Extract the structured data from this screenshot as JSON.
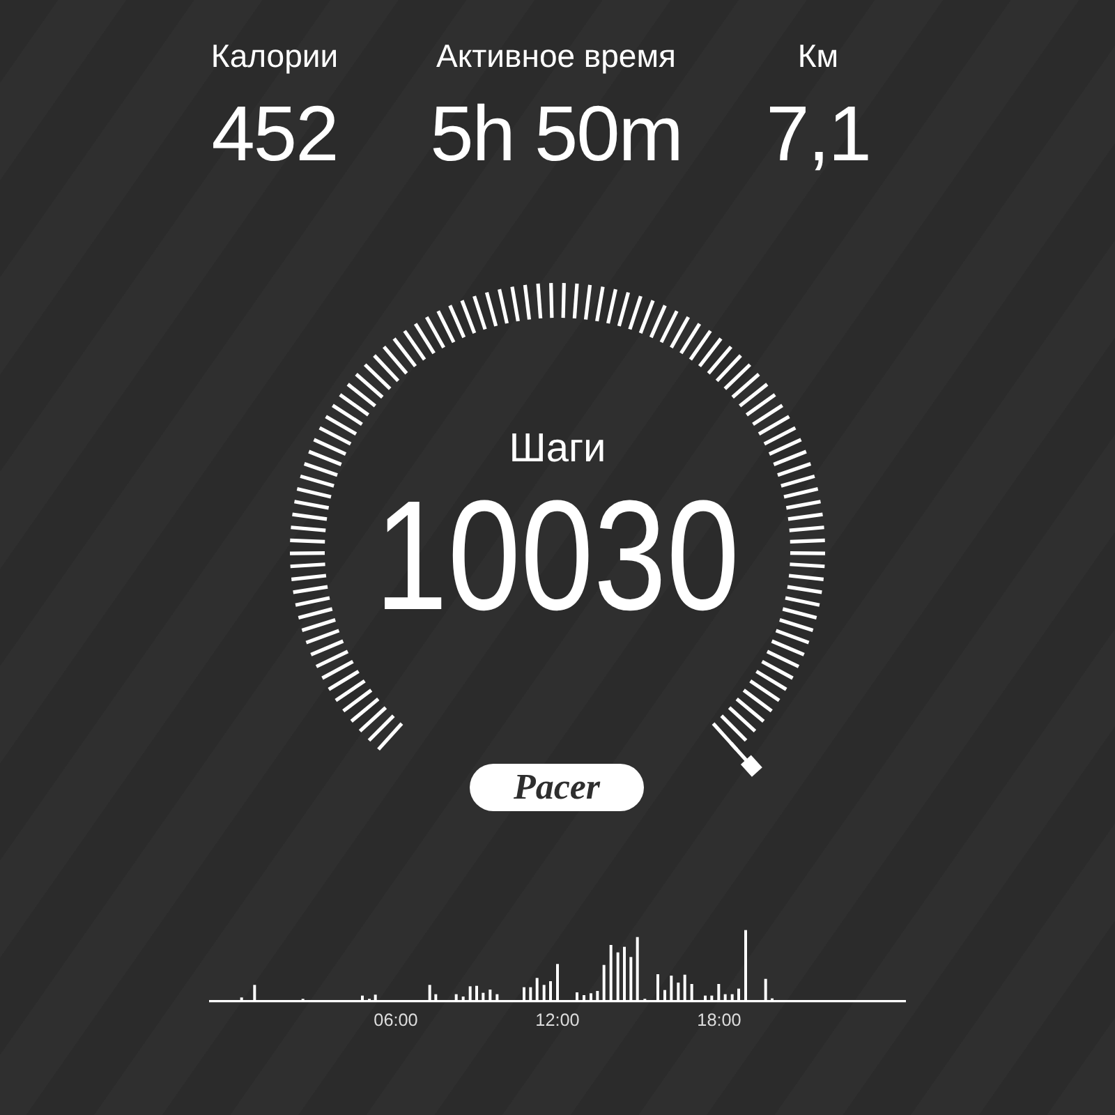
{
  "stats": [
    {
      "label": "Калории",
      "value": "452"
    },
    {
      "label": "Активное время",
      "value": "5h 50m"
    },
    {
      "label": "Км",
      "value": "7,1"
    }
  ],
  "steps": {
    "label": "Шаги",
    "value": "10030"
  },
  "badge": "Pacer",
  "activity": {
    "time_labels": [
      "06:00",
      "12:00",
      "18:00"
    ]
  }
}
